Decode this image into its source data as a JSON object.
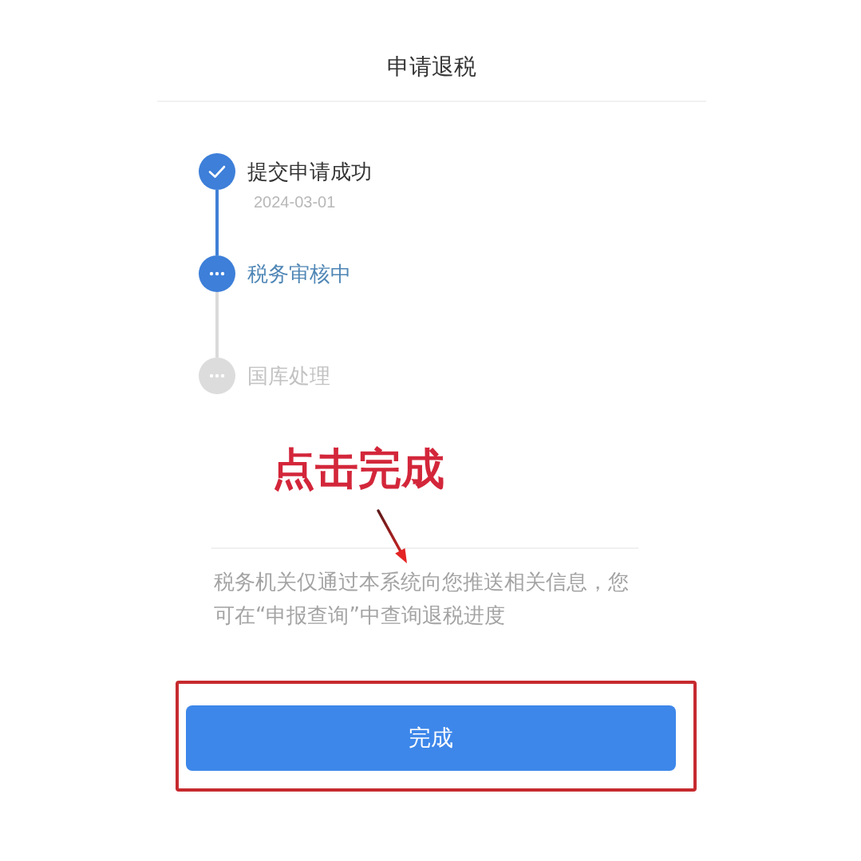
{
  "header": {
    "title": "申请退税"
  },
  "steps": [
    {
      "label": "提交申请成功",
      "date": "2024-03-01",
      "kind": "done"
    },
    {
      "label": "税务审核中",
      "kind": "active"
    },
    {
      "label": "国库处理",
      "kind": "pending"
    }
  ],
  "annotation": {
    "text": "点击完成"
  },
  "notice": "税务机关仅通过本系统向您推送相关信息，您可在“申报查询”中查询退税进度",
  "done_button": {
    "label": "完成",
    "highlighted": true
  }
}
